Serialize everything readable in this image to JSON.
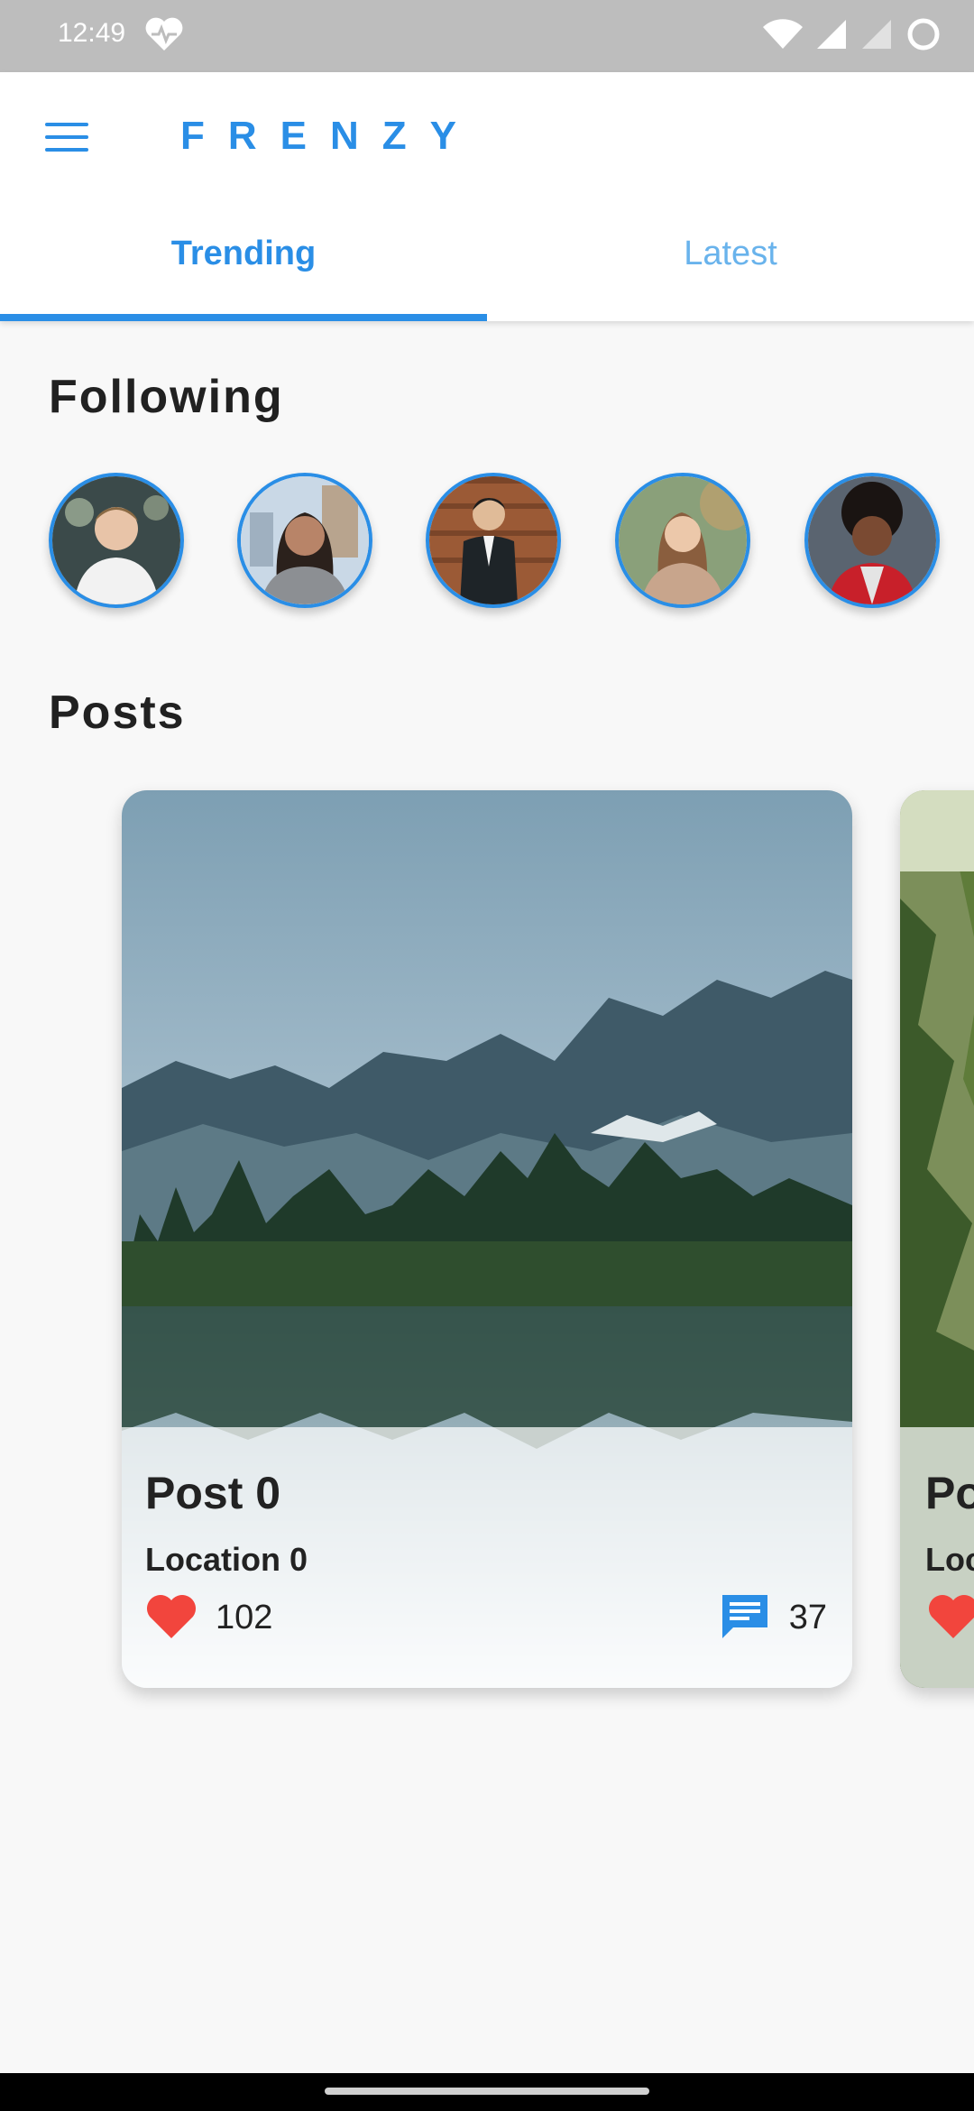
{
  "status_bar": {
    "time": "12:49",
    "icons": [
      "heart-monitor-icon",
      "wifi-icon",
      "signal-icon",
      "signal-icon",
      "loading-icon"
    ]
  },
  "app": {
    "title": "FRENZY",
    "menu_icon": "menu-icon",
    "accent_color": "#2a8ee6"
  },
  "tabs": [
    {
      "label": "Trending",
      "selected": true
    },
    {
      "label": "Latest",
      "selected": false
    }
  ],
  "following": {
    "title": "Following",
    "avatars": [
      "avatar-1",
      "avatar-2",
      "avatar-3",
      "avatar-4",
      "avatar-5"
    ]
  },
  "posts": {
    "title": "Posts",
    "items": [
      {
        "title": "Post 0",
        "location": "Location 0",
        "likes": "102",
        "comments": "37"
      },
      {
        "title": "Po",
        "location": "Loc",
        "likes": "",
        "comments": ""
      }
    ]
  }
}
